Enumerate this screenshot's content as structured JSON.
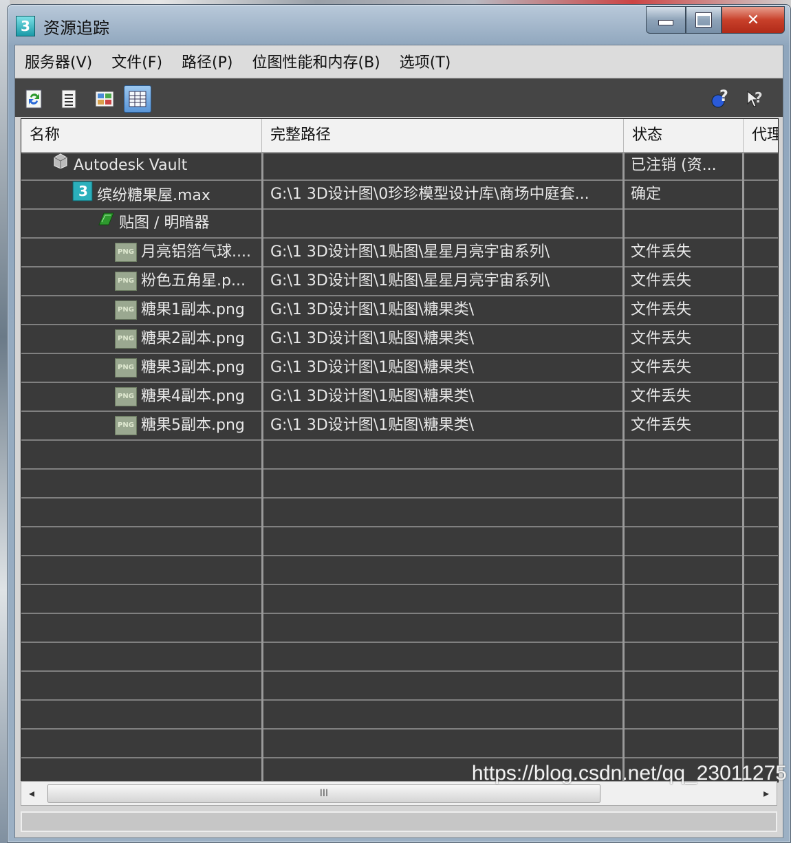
{
  "window": {
    "title": "资源追踪",
    "app_icon_text": "3"
  },
  "menu": [
    "服务器(V)",
    "文件(F)",
    "路径(P)",
    "位图性能和内存(B)",
    "选项(T)"
  ],
  "toolbar": {
    "buttons": [
      "refresh-icon",
      "list-icon",
      "thumbnail-icon",
      "table-view-icon"
    ],
    "right_buttons": [
      "help-icon",
      "context-help-icon"
    ]
  },
  "table": {
    "headers": [
      "名称",
      "完整路径",
      "状态",
      "代理"
    ],
    "rows": [
      {
        "name": "Autodesk Vault",
        "path": "",
        "status": "已注销 (资...",
        "icon": "vault-icon",
        "indent": 1
      },
      {
        "name": "缤纷糖果屋.max",
        "path": "G:\\1 3D设计图\\0珍珍模型设计库\\商场中庭套...",
        "status": "确定",
        "icon": "max-file-icon",
        "indent": 2
      },
      {
        "name": "贴图 / 明暗器",
        "path": "",
        "status": "",
        "icon": "maps-icon",
        "indent": 3
      },
      {
        "name": "月亮铝箔气球....",
        "path": "G:\\1 3D设计图\\1贴图\\星星月亮宇宙系列\\",
        "status": "文件丢失",
        "icon": "png-icon",
        "indent": 4
      },
      {
        "name": "粉色五角星.p...",
        "path": "G:\\1 3D设计图\\1贴图\\星星月亮宇宙系列\\",
        "status": "文件丢失",
        "icon": "png-icon",
        "indent": 4
      },
      {
        "name": "糖果1副本.png",
        "path": "G:\\1 3D设计图\\1贴图\\糖果类\\",
        "status": "文件丢失",
        "icon": "png-icon",
        "indent": 4
      },
      {
        "name": "糖果2副本.png",
        "path": "G:\\1 3D设计图\\1贴图\\糖果类\\",
        "status": "文件丢失",
        "icon": "png-icon",
        "indent": 4
      },
      {
        "name": "糖果3副本.png",
        "path": "G:\\1 3D设计图\\1贴图\\糖果类\\",
        "status": "文件丢失",
        "icon": "png-icon",
        "indent": 4
      },
      {
        "name": "糖果4副本.png",
        "path": "G:\\1 3D设计图\\1贴图\\糖果类\\",
        "status": "文件丢失",
        "icon": "png-icon",
        "indent": 4
      },
      {
        "name": "糖果5副本.png",
        "path": "G:\\1 3D设计图\\1贴图\\糖果类\\",
        "status": "文件丢失",
        "icon": "png-icon",
        "indent": 4
      }
    ],
    "png_badge": "PNG"
  },
  "scrollbar": {
    "left": "◂",
    "right": "▸",
    "thumb_grip": "III"
  },
  "watermark": "https://blog.csdn.net/qq_23011275"
}
